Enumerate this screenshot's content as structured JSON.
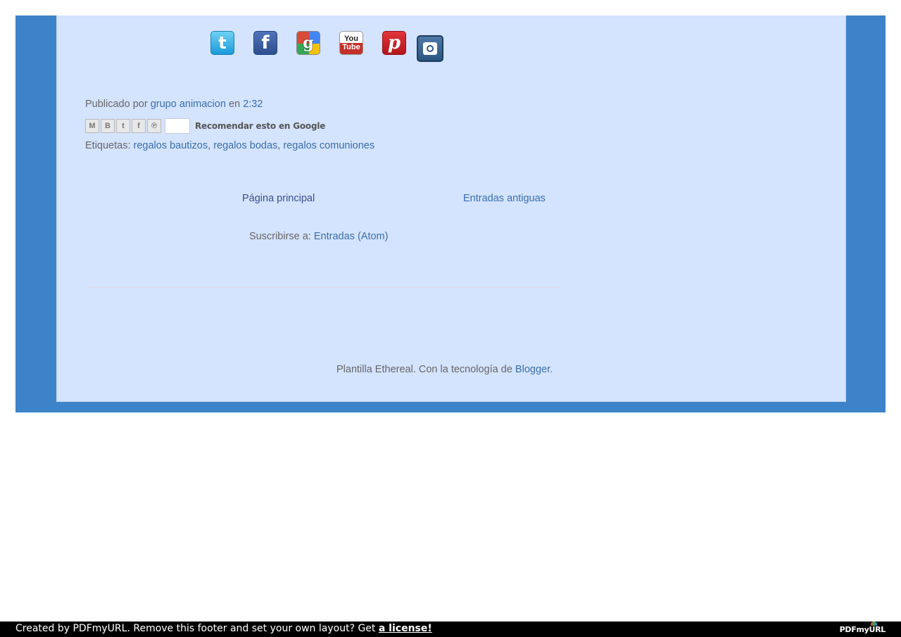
{
  "social_icons": [
    {
      "name": "twitter",
      "glyph": "t"
    },
    {
      "name": "facebook",
      "glyph": "f"
    },
    {
      "name": "google-plus",
      "glyph": "g"
    },
    {
      "name": "youtube",
      "glyph_top": "You",
      "glyph_bottom": "Tube"
    },
    {
      "name": "pinterest",
      "glyph": "p"
    },
    {
      "name": "instagram"
    }
  ],
  "post_footer": {
    "prefix": "Publicado por",
    "author": "grupo animacion",
    "middle": "en",
    "time": "2:32"
  },
  "share": {
    "buttons": [
      "email",
      "blogger",
      "twitter",
      "facebook",
      "pinterest"
    ],
    "glyphs": [
      "M",
      "B",
      "t",
      "f",
      "℗"
    ],
    "recommend_label": "Recomendar esto en Google"
  },
  "labels": {
    "prefix": "Etiquetas:",
    "items": [
      "regalos bautizos",
      "regalos bodas",
      "regalos comuniones"
    ]
  },
  "pager": {
    "home": "Página principal",
    "older": "Entradas antiguas"
  },
  "subscribe": {
    "prefix": "Suscribirse a:",
    "link": "Entradas (Atom)"
  },
  "attribution": {
    "text": "Plantilla Ethereal. Con la tecnología de",
    "link": "Blogger",
    "suffix": "."
  },
  "pdf_footer": {
    "message": "Created by PDFmyURL. Remove this footer and set your own layout? Get",
    "link": "a license!",
    "logo": "PDFmyURL"
  },
  "colors": {
    "outer_background": "#3d83c9",
    "content_background": "#d4e3fe",
    "link": "#3a6fa8"
  }
}
